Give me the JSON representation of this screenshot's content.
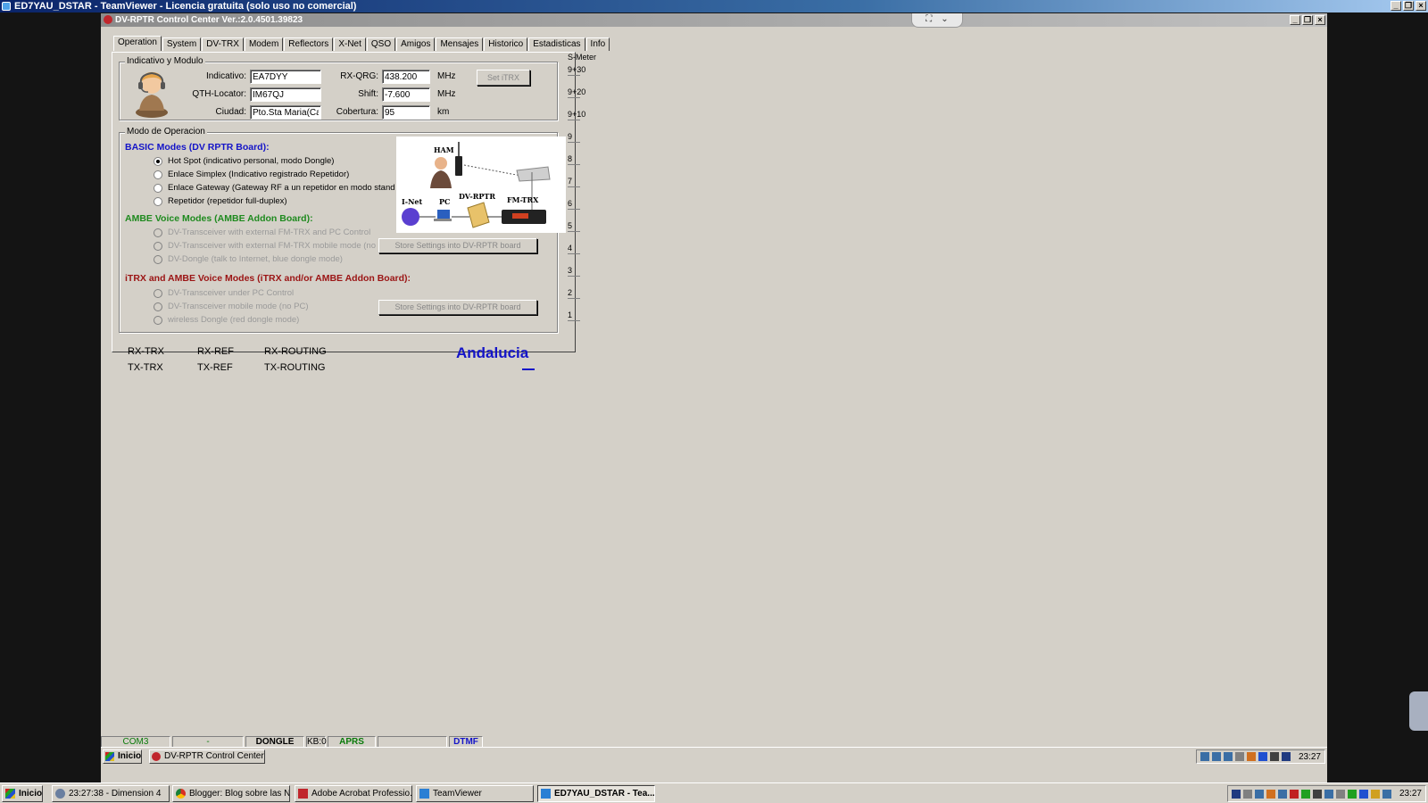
{
  "outer_window": {
    "title": "ED7YAU_DSTAR - TeamViewer - Licencia gratuita (solo uso no comercial)",
    "controls": [
      "_",
      "❐",
      "×"
    ]
  },
  "app": {
    "title": "DV-RPTR Control Center Ver.:2.0.4501.39823",
    "controls": [
      "_",
      "❐",
      "×"
    ],
    "tabs": [
      "Operation",
      "System",
      "DV-TRX",
      "Modem",
      "Reflectors",
      "X-Net",
      "QSO",
      "Amigos",
      "Mensajes",
      "Historico",
      "Estadisticas",
      "Info"
    ],
    "active_tab": "Operation"
  },
  "callsign_group": {
    "legend": "Indicativo y Modulo",
    "indicativo_label": "Indicativo:",
    "indicativo_value": "EA7DYY",
    "qth_label": "QTH-Locator:",
    "qth_value": "IM67QJ",
    "ciudad_label": "Ciudad:",
    "ciudad_value": "Pto.Sta Maria(Cadiz",
    "rxqrg_label": "RX-QRG:",
    "rxqrg_value": "438.200",
    "rxqrg_unit": "MHz",
    "shift_label": "Shift:",
    "shift_value": "-7.600",
    "shift_unit": "MHz",
    "cobertura_label": "Cobertura:",
    "cobertura_value": "95",
    "cobertura_unit": "km",
    "set_button": "Set iTRX"
  },
  "mode_group": {
    "legend": "Modo de Operacion",
    "basic_title": "BASIC Modes (DV RPTR Board):",
    "basic_options": [
      "Hot Spot (indicativo personal, modo Dongle)",
      "Enlace Simplex (Indicativo registrado Repetidor)",
      "Enlace Gateway (Gateway RF a un repetidor en modo stand alone)",
      "Repetidor (repetidor full-duplex)"
    ],
    "ambe_title": "AMBE Voice Modes (AMBE Addon Board):",
    "ambe_options": [
      "DV-Transceiver with external FM-TRX and PC Control",
      "DV-Transceiver with external FM-TRX mobile mode (no PC)",
      "DV-Dongle (talk to Internet, blue dongle mode)"
    ],
    "itrx_title": "iTRX and AMBE Voice Modes (iTRX and/or AMBE Addon Board):",
    "itrx_options": [
      "DV-Transceiver under PC Control",
      "DV-Transceiver mobile mode (no PC)",
      "wireless Dongle (red dongle mode)"
    ],
    "store_button_1": "Store Settings into DV-RPTR board",
    "store_button_2": "Store Settings into DV-RPTR board",
    "diagram_labels": {
      "ham": "HAM",
      "inet": "I-Net",
      "pc": "PC",
      "dvrptr": "DV-RPTR",
      "fmtrx": "FM-TRX"
    }
  },
  "smeter": {
    "title": "S-Meter",
    "ticks": [
      "9+30",
      "9+20",
      "9+10",
      "9",
      "8",
      "7",
      "6",
      "5",
      "4",
      "3",
      "2",
      "1"
    ]
  },
  "routing": {
    "rx_trx": "RX-TRX",
    "rx_ref": "RX-REF",
    "rx_routing": "RX-ROUTING",
    "tx_trx": "TX-TRX",
    "tx_ref": "TX-REF",
    "tx_routing": "TX-ROUTING",
    "region": "Andalucia"
  },
  "statusbar": {
    "com": "COM3",
    "dash": "-",
    "dongle": "DONGLE Beep",
    "kb": "KB:0",
    "aprs": "APRS",
    "empty": "",
    "dtmf": "DTMF"
  },
  "inner_taskbar": {
    "start": "Inicio",
    "item": "DV-RPTR Control Center ...",
    "clock": "23:27"
  },
  "outer_taskbar": {
    "start": "Inicio",
    "items": [
      "23:27:38 - Dimension 4",
      "Blogger: Blog sobre las N...",
      "Adobe Acrobat Professio...",
      "TeamViewer",
      "ED7YAU_DSTAR - Tea..."
    ],
    "clock": "23:27"
  },
  "colors": {
    "basic_title": "#1414c8",
    "ambe_title": "#1e8a1e",
    "itrx_title": "#9b1414",
    "status_green": "#0a7a0a",
    "dtmf_blue": "#1414c8"
  }
}
